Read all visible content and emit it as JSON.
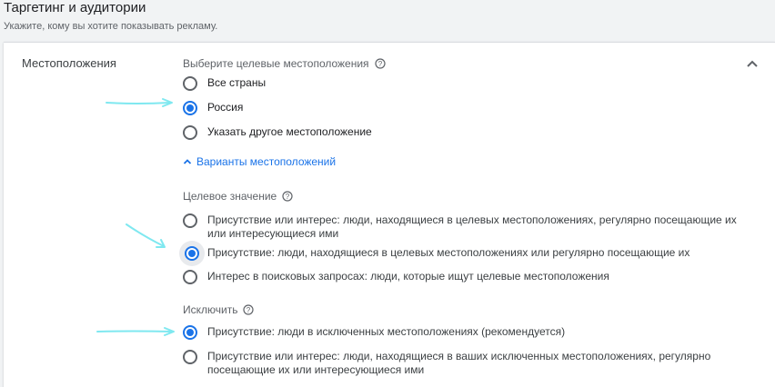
{
  "header": {
    "title": "Таргетинг и аудитории",
    "subtitle": "Укажите, кому вы хотите показывать рекламу."
  },
  "locations": {
    "section_label": "Местоположения",
    "group_title": "Выберите целевые местоположения",
    "options": [
      {
        "label": "Все страны",
        "selected": false
      },
      {
        "label": "Россия",
        "selected": true
      },
      {
        "label": "Указать другое местоположение",
        "selected": false
      }
    ],
    "options_link": "Варианты местоположений"
  },
  "target": {
    "group_title": "Целевое значение",
    "options": [
      {
        "line1": "Присутствие или интерес: люди, находящиеся в целевых местоположениях, регулярно посещающие их",
        "line2": "или интересующиеся ими",
        "selected": false
      },
      {
        "line1": "Присутствие: люди, находящиеся в целевых местоположениях или регулярно посещающие их",
        "selected": true
      },
      {
        "line1": "Интерес в поисковых запросах: люди, которые ищут целевые местоположения",
        "selected": false
      }
    ]
  },
  "exclude": {
    "group_title": "Исключить",
    "options": [
      {
        "line1": "Присутствие: люди в исключенных местоположениях (рекомендуется)",
        "selected": true
      },
      {
        "line1": "Присутствие или интерес: люди, находящиеся в ваших исключенных местоположениях, регулярно",
        "line2": "посещающие их или интересующиеся ими",
        "selected": false
      }
    ]
  },
  "colors": {
    "accent": "#1a73e8",
    "annotation_arrow": "#7fe8f0"
  }
}
